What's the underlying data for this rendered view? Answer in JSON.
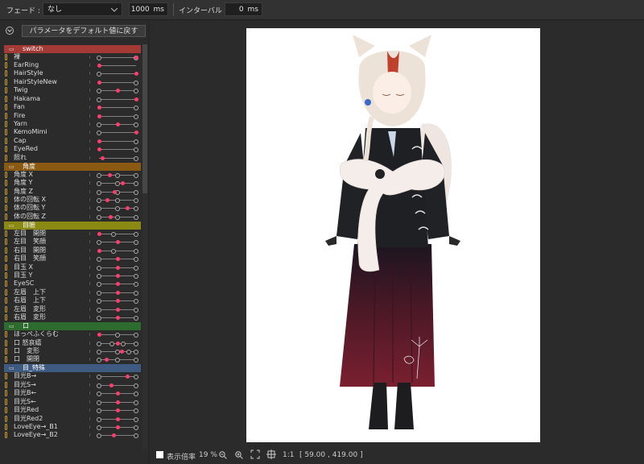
{
  "toolbar": {
    "fade_label": "フェード :",
    "fade_value": "なし",
    "duration_value": "1000",
    "duration_unit": "ms",
    "interval_label": "インターバル :",
    "interval_value": "0",
    "interval_unit": "ms"
  },
  "panel": {
    "reset_label": "パラメータをデフォルト値に戻す",
    "groups": [
      {
        "name": "switch",
        "color": "#a33a36",
        "params": [
          {
            "name": "裸",
            "pos": [
              0,
              1
            ],
            "handle": 1
          },
          {
            "name": "EarRing",
            "pos": [],
            "handle": 0
          },
          {
            "name": "HairStyle",
            "pos": [
              0
            ],
            "handle": 1
          },
          {
            "name": "HairStyleNew",
            "pos": [
              1
            ],
            "handle": 0
          },
          {
            "name": "Twig",
            "pos": [
              0,
              1
            ],
            "handle": 0.5
          },
          {
            "name": "Hakama",
            "pos": [
              0
            ],
            "handle": 1
          },
          {
            "name": "Fan",
            "pos": [
              1
            ],
            "handle": 0
          },
          {
            "name": "Fire",
            "pos": [
              1
            ],
            "handle": 0
          },
          {
            "name": "Yarn",
            "pos": [
              0,
              1
            ],
            "handle": 0.5
          },
          {
            "name": "KemoMimi",
            "pos": [
              0
            ],
            "handle": 1
          },
          {
            "name": "Cap",
            "pos": [
              1
            ],
            "handle": 0
          },
          {
            "name": "EyeRed",
            "pos": [
              1
            ],
            "handle": 0
          },
          {
            "name": "照れ",
            "pos": [
              1
            ],
            "handle": 0.1
          }
        ]
      },
      {
        "name": "角度",
        "color": "#8a5a12",
        "params": [
          {
            "name": "角度 X",
            "pos": [
              0,
              0.5,
              1
            ],
            "handle": 0.3
          },
          {
            "name": "角度 Y",
            "pos": [
              0,
              0.5,
              1
            ],
            "handle": 0.65
          },
          {
            "name": "角度 Z",
            "pos": [
              0,
              0.5,
              1
            ],
            "handle": 0.42
          },
          {
            "name": "体の回転 X",
            "pos": [
              0,
              0.5,
              1
            ],
            "handle": 0.22
          },
          {
            "name": "体の回転 Y",
            "pos": [
              0,
              0.5,
              1
            ],
            "handle": 0.78
          },
          {
            "name": "体の回転 Z",
            "pos": [
              0,
              0.5,
              1
            ],
            "handle": 0.32
          }
        ]
      },
      {
        "name": "目瞼",
        "color": "#8a8a12",
        "params": [
          {
            "name": "左目　開閉",
            "pos": [
              0.4,
              1
            ],
            "handle": 0
          },
          {
            "name": "左目　笑顔",
            "pos": [
              0,
              1
            ],
            "handle": 0.5
          },
          {
            "name": "右目　開閉",
            "pos": [
              0.4,
              1
            ],
            "handle": 0
          },
          {
            "name": "右目　笑顔",
            "pos": [
              0,
              1
            ],
            "handle": 0.5
          },
          {
            "name": "目玉 X",
            "pos": [
              0,
              1
            ],
            "handle": 0.5
          },
          {
            "name": "目玉 Y",
            "pos": [
              0,
              1
            ],
            "handle": 0.5
          },
          {
            "name": "EyeSC",
            "pos": [
              0,
              1
            ],
            "handle": 0.5
          },
          {
            "name": "左眉　上下",
            "pos": [
              0,
              1
            ],
            "handle": 0.5
          },
          {
            "name": "右眉　上下",
            "pos": [
              0,
              1
            ],
            "handle": 0.5
          },
          {
            "name": "左眉　変形",
            "pos": [
              0,
              1
            ],
            "handle": 0.5
          },
          {
            "name": "右眉　変形",
            "pos": [
              0,
              1
            ],
            "handle": 0.5
          }
        ]
      },
      {
        "name": "口",
        "color": "#2e6b2e",
        "params": [
          {
            "name": "ほっぺふくらむ",
            "pos": [
              0.5,
              1
            ],
            "handle": 0
          },
          {
            "name": "口 怒哀嬉",
            "pos": [
              0,
              0.35,
              0.65,
              1
            ],
            "handle": 0.5
          },
          {
            "name": "口　変形",
            "pos": [
              0,
              0.5,
              0.8,
              1
            ],
            "handle": 0.62
          },
          {
            "name": "口　開閉",
            "pos": [
              0,
              0.5,
              1
            ],
            "handle": 0.2
          }
        ]
      },
      {
        "name": "目_特殊",
        "color": "#3e5a80",
        "params": [
          {
            "name": "目光B→",
            "pos": [
              0,
              1
            ],
            "handle": 0.78
          },
          {
            "name": "目光S→",
            "pos": [
              0,
              1
            ],
            "handle": 0.33
          },
          {
            "name": "目光B←",
            "pos": [
              0,
              1
            ],
            "handle": 0.5
          },
          {
            "name": "目光S←",
            "pos": [
              0,
              1
            ],
            "handle": 0.5
          },
          {
            "name": "目光Red",
            "pos": [
              0,
              1
            ],
            "handle": 0.5
          },
          {
            "name": "目光Red2",
            "pos": [
              0,
              1
            ],
            "handle": 0.5
          },
          {
            "name": "LoveEye→_B1",
            "pos": [
              0,
              1
            ],
            "handle": 0.5
          },
          {
            "name": "LoveEye→_B2",
            "pos": [
              0,
              1
            ],
            "handle": 0.4
          }
        ]
      }
    ]
  },
  "statusbar": {
    "display_label": "表示倍率",
    "zoom": "19 %",
    "one_to_one": "1:1",
    "coords": "[  59.00 , 419.00 ]"
  },
  "icons": [
    "collapse-icon",
    "dropdown-arrow-icon",
    "folder-icon",
    "zoom-out-icon",
    "zoom-in-icon",
    "fit-screen-icon",
    "crosshair-icon"
  ],
  "colors": {
    "handle": "#ff3d6e",
    "background": "#2b2b2b",
    "canvas": "#ffffff"
  }
}
